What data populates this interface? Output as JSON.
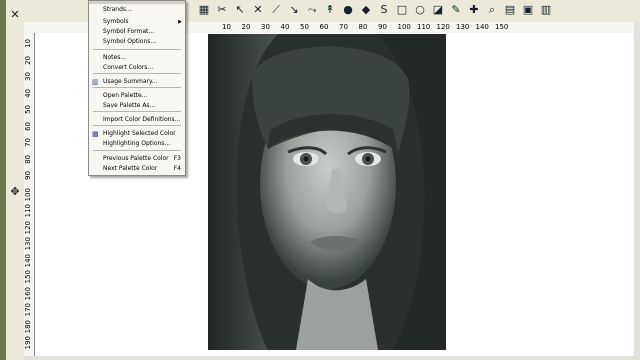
{
  "menu": {
    "items": [
      {
        "label": "Strands...",
        "shortcut": "",
        "submenu": false,
        "icon": ""
      },
      {
        "label": "Symbols",
        "shortcut": "",
        "submenu": true,
        "icon": ""
      },
      {
        "label": "Symbol Format...",
        "shortcut": "",
        "submenu": false,
        "icon": ""
      },
      {
        "label": "Symbol Options...",
        "shortcut": "",
        "submenu": false,
        "icon": ""
      },
      {
        "label": "Notes...",
        "shortcut": "",
        "submenu": false,
        "icon": ""
      },
      {
        "label": "Convert Colors...",
        "shortcut": "",
        "submenu": false,
        "icon": ""
      },
      {
        "label": "Usage Summary...",
        "shortcut": "",
        "submenu": false,
        "icon": "chart-icon"
      },
      {
        "label": "Open Palette...",
        "shortcut": "",
        "submenu": false,
        "icon": ""
      },
      {
        "label": "Save Palette As...",
        "shortcut": "",
        "submenu": false,
        "icon": ""
      },
      {
        "label": "Import Color Definitions...",
        "shortcut": "",
        "submenu": false,
        "icon": ""
      },
      {
        "label": "Highlight Selected Color",
        "shortcut": "",
        "submenu": false,
        "icon": "highlight-icon"
      },
      {
        "label": "Highlighting Options...",
        "shortcut": "",
        "submenu": false,
        "icon": ""
      },
      {
        "label": "Previous Palette Color",
        "shortcut": "F3",
        "submenu": false,
        "icon": ""
      },
      {
        "label": "Next Palette Color",
        "shortcut": "F4",
        "submenu": false,
        "icon": ""
      }
    ]
  },
  "ruler": {
    "horizontal": [
      "10",
      "20",
      "30",
      "40",
      "50",
      "60",
      "70",
      "80",
      "90",
      "100",
      "110",
      "120",
      "130",
      "140",
      "150"
    ],
    "vertical": [
      "10",
      "20",
      "30",
      "40",
      "50",
      "60",
      "70",
      "80",
      "90",
      "100",
      "110",
      "120",
      "130",
      "140",
      "150",
      "160",
      "170",
      "180",
      "190"
    ]
  },
  "toolbar": {
    "icons": [
      "table-icon",
      "scissors-icon",
      "select-arrow-icon",
      "cross-stitch-icon",
      "half-stitch-icon",
      "quarter-stitch-icon",
      "backstitch-icon",
      "long-stitch-icon",
      "french-knot-icon",
      "bead-icon",
      "text-icon",
      "rectangle-icon",
      "ellipse-icon",
      "fill-icon",
      "eyedropper-icon",
      "paint-icon",
      "zoom-icon",
      "grid-icon",
      "view-icon",
      "options-icon"
    ]
  },
  "colors": {
    "accent": "#2a4aa0",
    "portrait_bg": "#2a302d"
  }
}
